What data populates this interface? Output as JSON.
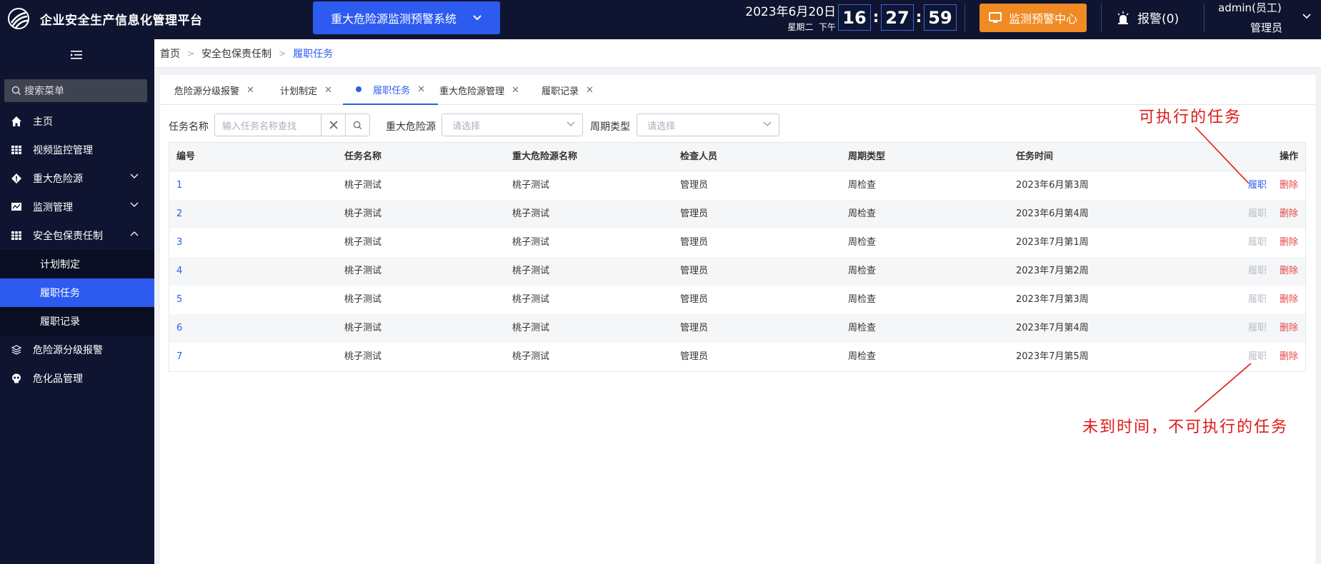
{
  "header": {
    "app_title": "企业安全生产信息化管理平台",
    "system_select": "重大危险源监测预警系统",
    "date": "2023年6月20日",
    "weekday": "星期二",
    "period": "下午",
    "clock": {
      "hour": "16",
      "minute": "27",
      "second": "59",
      "separator": ":"
    },
    "monitor_button": "监测预警中心",
    "alarm_label": "报警(0)",
    "user_name": "admin(员工)",
    "user_role": "管理员",
    "colors": {
      "bar": "#0f1530",
      "primary": "#2d5bf0",
      "orange": "#f08a24"
    }
  },
  "sidebar": {
    "search_placeholder": "搜索菜单",
    "items": [
      {
        "label": "主页",
        "icon": "home-icon"
      },
      {
        "label": "视频监控管理",
        "icon": "grid-icon"
      },
      {
        "label": "重大危险源",
        "icon": "diamond-warning-icon",
        "expandable": true
      },
      {
        "label": "监测管理",
        "icon": "monitor-chart-icon",
        "expandable": true
      },
      {
        "label": "安全包保责任制",
        "icon": "table-icon",
        "expanded": true,
        "children": [
          "计划制定",
          "履职任务",
          "履职记录"
        ],
        "active_child": "履职任务"
      },
      {
        "label": "危险源分级报警",
        "icon": "layers-icon"
      },
      {
        "label": "危化品管理",
        "icon": "skull-icon"
      }
    ]
  },
  "breadcrumb": [
    "首页",
    "安全包保责任制",
    "履职任务"
  ],
  "tabs": [
    {
      "label": "危险源分级报警",
      "active": false
    },
    {
      "label": "计划制定",
      "active": false
    },
    {
      "label": "履职任务",
      "active": true
    },
    {
      "label": "重大危险源管理",
      "active": false
    },
    {
      "label": "履职记录",
      "active": false
    }
  ],
  "filters": {
    "task_name_label": "任务名称",
    "task_name_placeholder": "输入任务名称查找",
    "hazard_label": "重大危险源",
    "hazard_placeholder": "请选择",
    "cycle_label": "周期类型",
    "cycle_placeholder": "请选择"
  },
  "table": {
    "columns": [
      "编号",
      "任务名称",
      "重大危险源名称",
      "检查人员",
      "周期类型",
      "任务时间",
      "操作"
    ],
    "rows": [
      {
        "id": "1",
        "task": "桃子测试",
        "hazard": "桃子测试",
        "inspector": "管理员",
        "cycle": "周检查",
        "time": "2023年6月第3周",
        "perform": "履职",
        "perform_enabled": true,
        "delete": "删除"
      },
      {
        "id": "2",
        "task": "桃子测试",
        "hazard": "桃子测试",
        "inspector": "管理员",
        "cycle": "周检查",
        "time": "2023年6月第4周",
        "perform": "履职",
        "perform_enabled": false,
        "delete": "删除"
      },
      {
        "id": "3",
        "task": "桃子测试",
        "hazard": "桃子测试",
        "inspector": "管理员",
        "cycle": "周检查",
        "time": "2023年7月第1周",
        "perform": "履职",
        "perform_enabled": false,
        "delete": "删除"
      },
      {
        "id": "4",
        "task": "桃子测试",
        "hazard": "桃子测试",
        "inspector": "管理员",
        "cycle": "周检查",
        "time": "2023年7月第2周",
        "perform": "履职",
        "perform_enabled": false,
        "delete": "删除"
      },
      {
        "id": "5",
        "task": "桃子测试",
        "hazard": "桃子测试",
        "inspector": "管理员",
        "cycle": "周检查",
        "time": "2023年7月第3周",
        "perform": "履职",
        "perform_enabled": false,
        "delete": "删除"
      },
      {
        "id": "6",
        "task": "桃子测试",
        "hazard": "桃子测试",
        "inspector": "管理员",
        "cycle": "周检查",
        "time": "2023年7月第4周",
        "perform": "履职",
        "perform_enabled": false,
        "delete": "删除"
      },
      {
        "id": "7",
        "task": "桃子测试",
        "hazard": "桃子测试",
        "inspector": "管理员",
        "cycle": "周检查",
        "time": "2023年7月第5周",
        "perform": "履职",
        "perform_enabled": false,
        "delete": "删除"
      }
    ]
  },
  "annotations": {
    "executable": "可执行的任务",
    "not_executable": "未到时间，不可执行的任务",
    "color": "#e01818"
  }
}
